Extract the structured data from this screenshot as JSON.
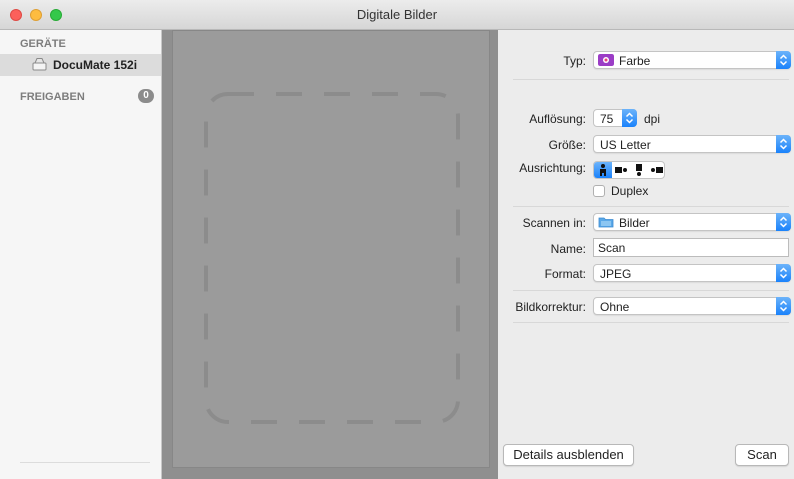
{
  "window": {
    "title": "Digitale Bilder"
  },
  "sidebar": {
    "devices_header": "GERÄTE",
    "device": {
      "label": "DocuMate 152i",
      "icon": "scanner-icon"
    },
    "shares_header": "FREIGABEN",
    "shares_count": "0"
  },
  "settings": {
    "type": {
      "label": "Typ:",
      "value": "Farbe",
      "icon": "color-icon"
    },
    "resolution": {
      "label": "Auflösung:",
      "value": "75",
      "unit": "dpi"
    },
    "size": {
      "label": "Größe:",
      "value": "US Letter"
    },
    "orientation": {
      "label": "Ausrichtung:",
      "selected": "portrait"
    },
    "duplex": {
      "label": "Duplex",
      "checked": false
    },
    "scan_to": {
      "label": "Scannen in:",
      "value": "Bilder",
      "icon": "folder-icon"
    },
    "name": {
      "label": "Name:",
      "value": "Scan"
    },
    "format": {
      "label": "Format:",
      "value": "JPEG"
    },
    "correction": {
      "label": "Bildkorrektur:",
      "value": "Ohne"
    }
  },
  "buttons": {
    "details": "Details ausblenden",
    "scan": "Scan"
  },
  "colors": {
    "accent": "#1a82fb",
    "preview_bg": "#8f8f8f"
  }
}
